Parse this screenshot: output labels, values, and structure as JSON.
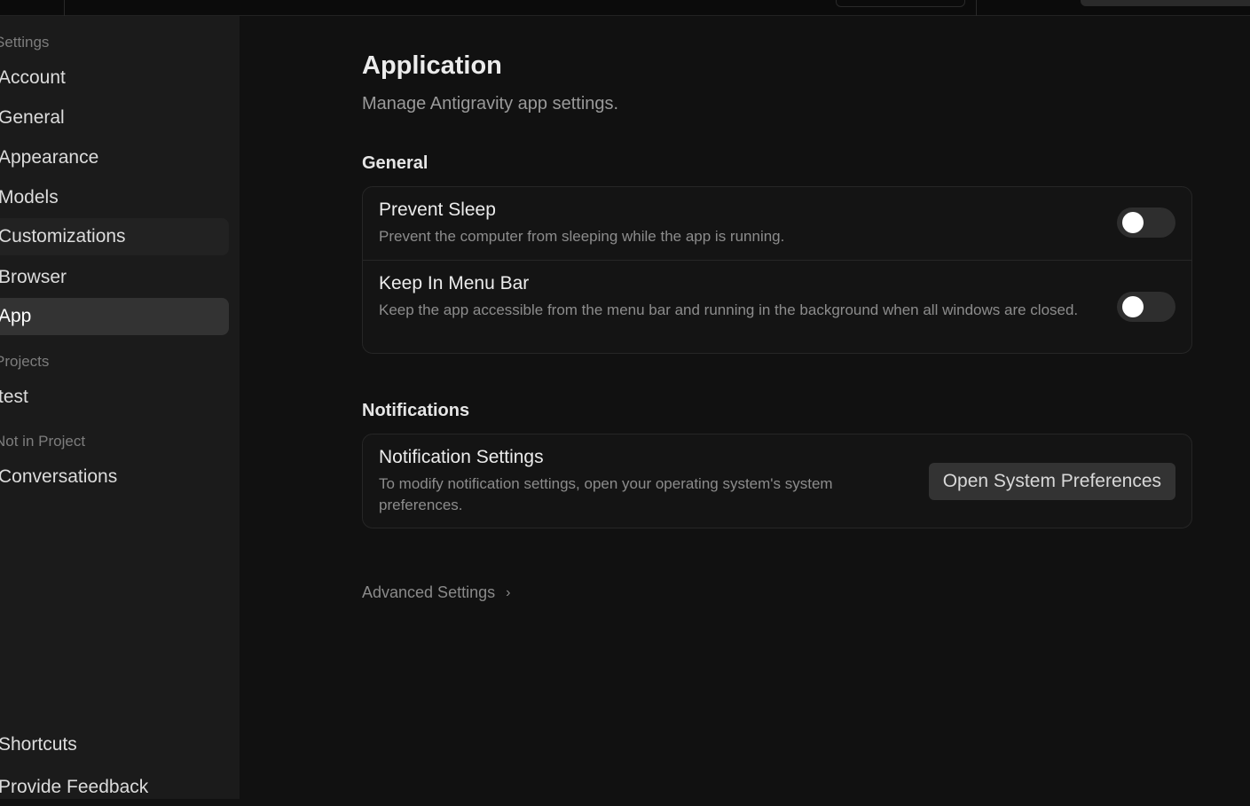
{
  "sidebar": {
    "groups": [
      {
        "label": "Settings"
      },
      {
        "label": "Projects"
      },
      {
        "label": "Not in Project"
      }
    ],
    "items": [
      {
        "label": "Account"
      },
      {
        "label": "General"
      },
      {
        "label": "Appearance"
      },
      {
        "label": "Models"
      },
      {
        "label": "Customizations"
      },
      {
        "label": "Browser"
      },
      {
        "label": "App"
      },
      {
        "label": "test"
      },
      {
        "label": "Conversations"
      },
      {
        "label": "Shortcuts"
      },
      {
        "label": "Provide Feedback"
      }
    ],
    "active_item": "App"
  },
  "main": {
    "title": "Application",
    "subtitle": "Manage Antigravity app settings.",
    "general": {
      "title": "General",
      "rows": [
        {
          "title": "Prevent Sleep",
          "desc": "Prevent the computer from sleeping while the app is running.",
          "enabled": false
        },
        {
          "title": "Keep In Menu Bar",
          "desc": "Keep the app accessible from the menu bar and running in the background when all windows are closed.",
          "enabled": false
        }
      ]
    },
    "notifications": {
      "title": "Notifications",
      "row": {
        "title": "Notification Settings",
        "desc": "To modify notification settings, open your operating system's system preferences.",
        "button_label": "Open System Preferences"
      }
    },
    "advanced_label": "Advanced Settings"
  },
  "colors": {
    "background": "#111111",
    "sidebar": "#1b1b1b",
    "active_item": "#333333",
    "toggle_off": "#2e2e2e"
  },
  "icons": {
    "advanced": "chevron-right-icon"
  }
}
